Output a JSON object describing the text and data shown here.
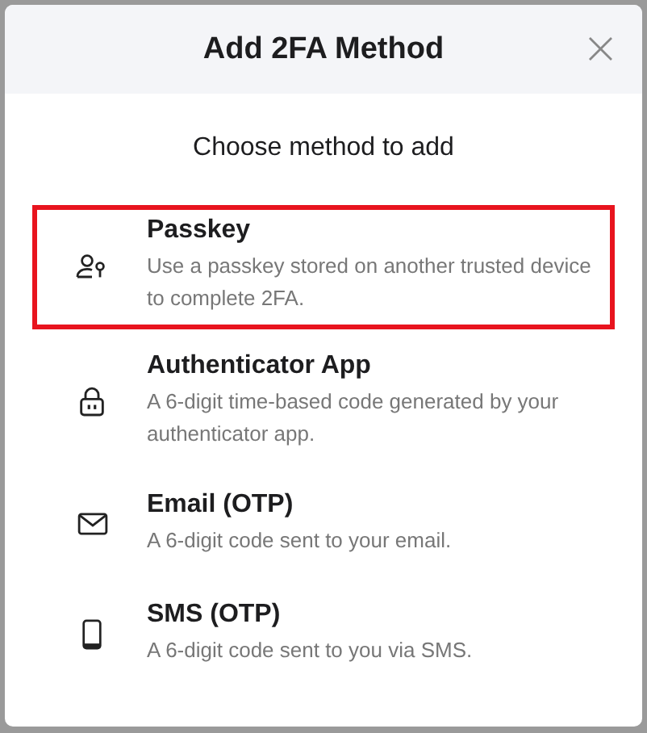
{
  "dialog": {
    "title": "Add 2FA Method",
    "close": "×"
  },
  "subtitle": "Choose method to add",
  "methods": [
    {
      "kind": "passkey",
      "title": "Passkey",
      "description": "Use a passkey stored on another trusted device to complete 2FA.",
      "selected": true
    },
    {
      "kind": "authenticator",
      "title": "Authenticator App",
      "description": "A 6-digit time-based code generated by your authenticator app.",
      "selected": false
    },
    {
      "kind": "email",
      "title": "Email (OTP)",
      "description": "A 6-digit code sent to your email.",
      "selected": false
    },
    {
      "kind": "sms",
      "title": "SMS (OTP)",
      "description": "A 6-digit code sent to you via SMS.",
      "selected": false
    }
  ]
}
